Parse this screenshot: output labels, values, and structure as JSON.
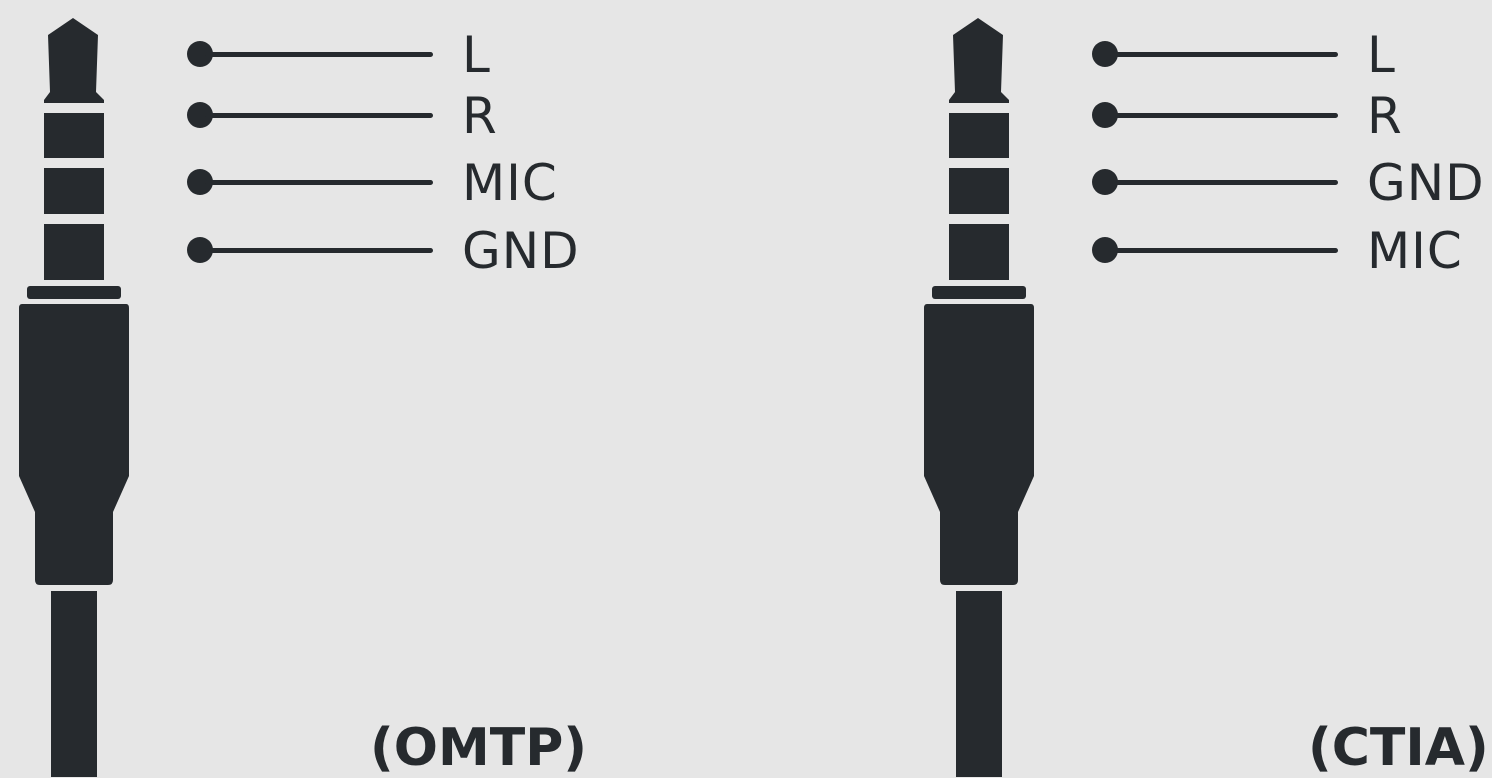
{
  "colors": {
    "background": "#e6e6e6",
    "ink": "#262a2e"
  },
  "omtp": {
    "pins": [
      {
        "label": "L"
      },
      {
        "label": "R"
      },
      {
        "label": "MIC"
      },
      {
        "label": "GND"
      }
    ],
    "standard_label": "(OMTP)"
  },
  "ctia": {
    "pins": [
      {
        "label": "L"
      },
      {
        "label": "R"
      },
      {
        "label": "GND"
      },
      {
        "label": "MIC"
      }
    ],
    "standard_label": "(CTIA)"
  }
}
